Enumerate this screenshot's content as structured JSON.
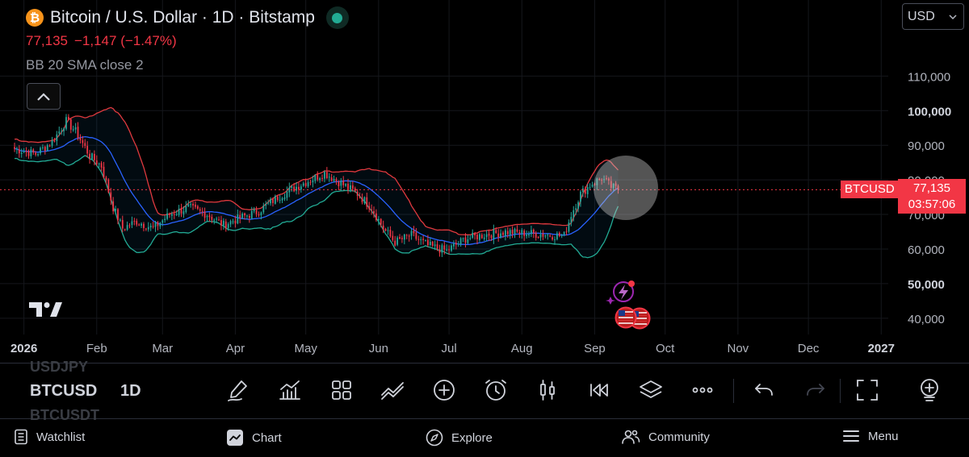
{
  "header": {
    "symbol_name": "Bitcoin / U.S. Dollar · 1D · Bitstamp",
    "coin_glyph": "₿",
    "last_price": "77,135",
    "change": "−1,147 (−1.47%)",
    "indicator": "BB 20 SMA close 2"
  },
  "currency": {
    "selected": "USD"
  },
  "price_tag": {
    "symbol": "BTCUSD",
    "price": "77,135",
    "countdown": "03:57:06"
  },
  "colors": {
    "up": "#26a69a",
    "down": "#f23645",
    "bb_upper": "#e0393e",
    "bb_lower": "#22ab94",
    "bb_basis": "#2962ff",
    "background": "#000000"
  },
  "toolbar": {
    "symbol": "BTCUSD",
    "interval": "1D",
    "ghost_above": "USDJPY",
    "ghost_below": "BTCUSDT",
    "icons": [
      "pencil-draw-icon",
      "indicators-icon",
      "layouts-grid-icon",
      "trend-lines-icon",
      "add-icon",
      "alert-clock-icon",
      "candle-style-icon",
      "replay-icon",
      "layers-icon",
      "more-icon",
      "undo-icon",
      "redo-icon",
      "fullscreen-icon",
      "add-symbol-icon"
    ]
  },
  "bottom_nav": [
    {
      "label": "Watchlist",
      "icon": "watchlist-icon"
    },
    {
      "label": "Chart",
      "icon": "chart-icon"
    },
    {
      "label": "Explore",
      "icon": "compass-icon"
    },
    {
      "label": "Community",
      "icon": "community-icon"
    },
    {
      "label": "Menu",
      "icon": "menu-icon"
    }
  ],
  "chart_data": {
    "type": "candlestick",
    "title": "Bitcoin / U.S. Dollar · 1D · Bitstamp",
    "y_ticks": [
      {
        "value": 110000,
        "label": "110,000",
        "bold": false
      },
      {
        "value": 100000,
        "label": "100,000",
        "bold": true
      },
      {
        "value": 90000,
        "label": "90,000",
        "bold": false
      },
      {
        "value": 80000,
        "label": "80,000",
        "bold": false
      },
      {
        "value": 70000,
        "label": "70,000",
        "bold": false
      },
      {
        "value": 60000,
        "label": "60,000",
        "bold": false
      },
      {
        "value": 50000,
        "label": "50,000",
        "bold": true
      },
      {
        "value": 40000,
        "label": "40,000",
        "bold": false
      }
    ],
    "ylim": [
      36000,
      118000
    ],
    "x_ticks": [
      {
        "day": 0,
        "label": "2026",
        "bold": true
      },
      {
        "day": 31,
        "label": "Feb",
        "bold": false
      },
      {
        "day": 59,
        "label": "Mar",
        "bold": false
      },
      {
        "day": 90,
        "label": "Apr",
        "bold": false
      },
      {
        "day": 120,
        "label": "May",
        "bold": false
      },
      {
        "day": 151,
        "label": "Jun",
        "bold": false
      },
      {
        "day": 181,
        "label": "Jul",
        "bold": false
      },
      {
        "day": 212,
        "label": "Aug",
        "bold": false
      },
      {
        "day": 243,
        "label": "Sep",
        "bold": false
      },
      {
        "day": 273,
        "label": "Oct",
        "bold": false
      },
      {
        "day": 304,
        "label": "Nov",
        "bold": false
      },
      {
        "day": 334,
        "label": "Dec",
        "bold": false
      },
      {
        "day": 365,
        "label": "2027",
        "bold": true
      }
    ],
    "xlim": [
      -4,
      368
    ],
    "close_anchors": [
      [
        -4,
        89000
      ],
      [
        5,
        87500
      ],
      [
        12,
        91000
      ],
      [
        18,
        97000
      ],
      [
        22,
        94000
      ],
      [
        28,
        87000
      ],
      [
        33,
        84000
      ],
      [
        38,
        72000
      ],
      [
        42,
        66000
      ],
      [
        48,
        68000
      ],
      [
        55,
        66000
      ],
      [
        62,
        70000
      ],
      [
        70,
        72000
      ],
      [
        78,
        70000
      ],
      [
        85,
        67000
      ],
      [
        92,
        69000
      ],
      [
        100,
        71000
      ],
      [
        108,
        75000
      ],
      [
        116,
        78000
      ],
      [
        122,
        80000
      ],
      [
        128,
        82000
      ],
      [
        135,
        79000
      ],
      [
        142,
        76000
      ],
      [
        148,
        72000
      ],
      [
        153,
        66000
      ],
      [
        158,
        62000
      ],
      [
        165,
        64000
      ],
      [
        172,
        61000
      ],
      [
        180,
        59500
      ],
      [
        188,
        63000
      ],
      [
        195,
        64000
      ],
      [
        205,
        65000
      ],
      [
        215,
        64500
      ],
      [
        225,
        64000
      ],
      [
        230,
        63800
      ],
      [
        233,
        70000
      ],
      [
        237,
        76000
      ],
      [
        242,
        79000
      ],
      [
        246,
        80500
      ],
      [
        250,
        78000
      ],
      [
        253,
        77135
      ]
    ],
    "bb_period": 20,
    "bb_mult": 2,
    "last_price": 77135
  }
}
